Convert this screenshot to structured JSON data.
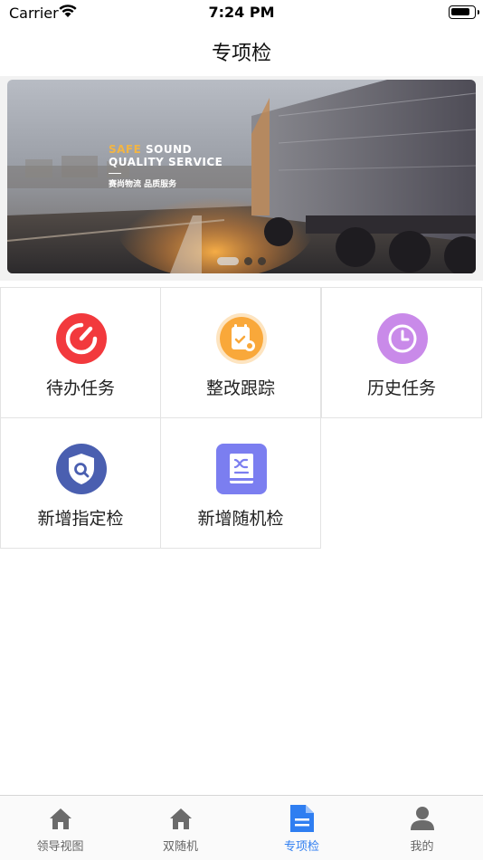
{
  "status_bar": {
    "carrier": "Carrier",
    "time": "7:24 PM",
    "battery_level": 0.85
  },
  "nav": {
    "title": "专项检"
  },
  "banner": {
    "line1_accent": "SAFE",
    "line1_rest": " SOUND",
    "line2": "QUALITY SERVICE",
    "line3": "赛尚物流  品质服务",
    "page_count": 3,
    "active_page": 1
  },
  "menu": [
    {
      "label": "待办任务",
      "icon": "speedometer-icon"
    },
    {
      "label": "整改跟踪",
      "icon": "clipboard-icon"
    },
    {
      "label": "历史任务",
      "icon": "clock-icon"
    },
    {
      "label": "新增指定检",
      "icon": "shield-search-icon"
    },
    {
      "label": "新增随机检",
      "icon": "shuffle-book-icon"
    }
  ],
  "tabs": [
    {
      "label": "领导视图",
      "icon": "home-icon",
      "active": false
    },
    {
      "label": "双随机",
      "icon": "home-icon",
      "active": false
    },
    {
      "label": "专项检",
      "icon": "document-icon",
      "active": true
    },
    {
      "label": "我的",
      "icon": "person-icon",
      "active": false
    }
  ],
  "colors": {
    "accent": "#2f7ef1",
    "task_icon": "#f2393d",
    "rectify_icon": "#f9a83a",
    "history_icon": "#c98ae9",
    "designated_icon": "#4a5fb0",
    "random_icon": "#7b7ef0"
  }
}
